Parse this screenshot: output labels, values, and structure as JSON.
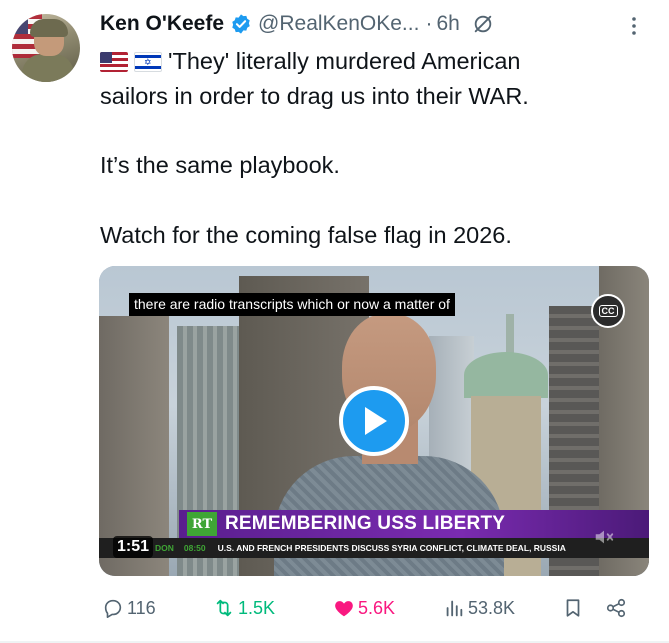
{
  "author": {
    "name": "Ken O'Keefe",
    "handle": "@RealKenOKe...",
    "separator": "·",
    "time": "6h",
    "verified_color": "#1d9bf0"
  },
  "post": {
    "lines": [
      "'They' literally murdered American",
      "sailors in order to drag us into their WAR.",
      "It’s the same playbook.",
      "Watch for the coming false flag in 2026."
    ],
    "flags": [
      "US flag",
      "Israel flag"
    ]
  },
  "video": {
    "caption": "there are radio transcripts which or now a matter of",
    "cc_label": "CC",
    "chyron_logo": "RT",
    "chyron_title": "REMEMBERING USS LIBERTY",
    "ticker_city": "DON",
    "ticker_time": "08:50",
    "ticker_headline": "U.S. AND FRENCH PRESIDENTS DISCUSS SYRIA CONFLICT, CLIMATE DEAL, RUSSIA",
    "duration": "1:51",
    "accent_color": "#1d9bf0"
  },
  "actions": {
    "replies": "116",
    "reposts": "1.5K",
    "likes": "5.6K",
    "views": "53.8K",
    "repost_color": "#00ba7c",
    "like_color": "#f91880"
  }
}
